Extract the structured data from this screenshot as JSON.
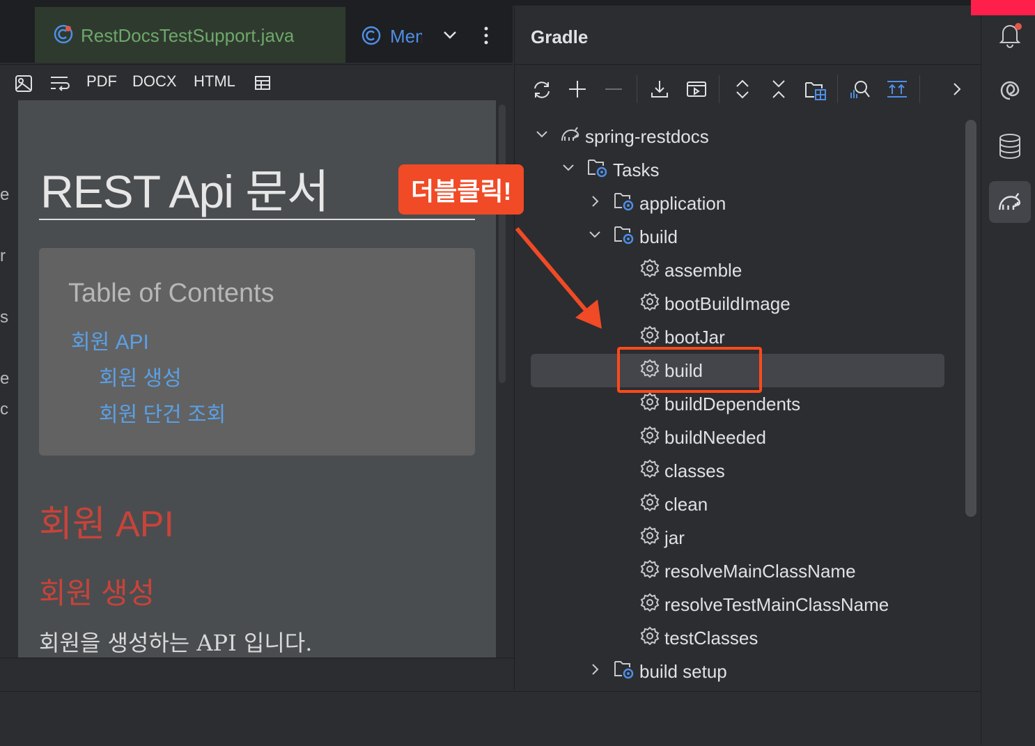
{
  "tabs": {
    "active_label": "RestDocsTestSupport.java",
    "other_label": "MemberApiDocsTest.java"
  },
  "preview_toolbar": {
    "pdf": "PDF",
    "docx": "DOCX",
    "html": "HTML"
  },
  "preview": {
    "title": "REST Api 문서",
    "toc_title": "Table of Contents",
    "toc_links": [
      "회원 API",
      "회원 생성",
      "회원 단건 조회"
    ],
    "h2": "회원 API",
    "h3": "회원 생성",
    "paragraph": "회원을 생성하는 API 입니다."
  },
  "gradle": {
    "title": "Gradle",
    "tree": {
      "project": "spring-restdocs",
      "tasks": "Tasks",
      "application": "application",
      "build_group": "build",
      "build_tasks": [
        "assemble",
        "bootBuildImage",
        "bootJar",
        "build",
        "buildDependents",
        "buildNeeded",
        "classes",
        "clean",
        "jar",
        "resolveMainClassName",
        "resolveTestMainClassName",
        "testClasses"
      ],
      "build_setup": "build setup"
    }
  },
  "annotation": {
    "label": "더블클릭!"
  },
  "colors": {
    "accent_red": "#f04a26",
    "link_blue": "#5aa0e6",
    "heading_red": "#c8433a"
  }
}
